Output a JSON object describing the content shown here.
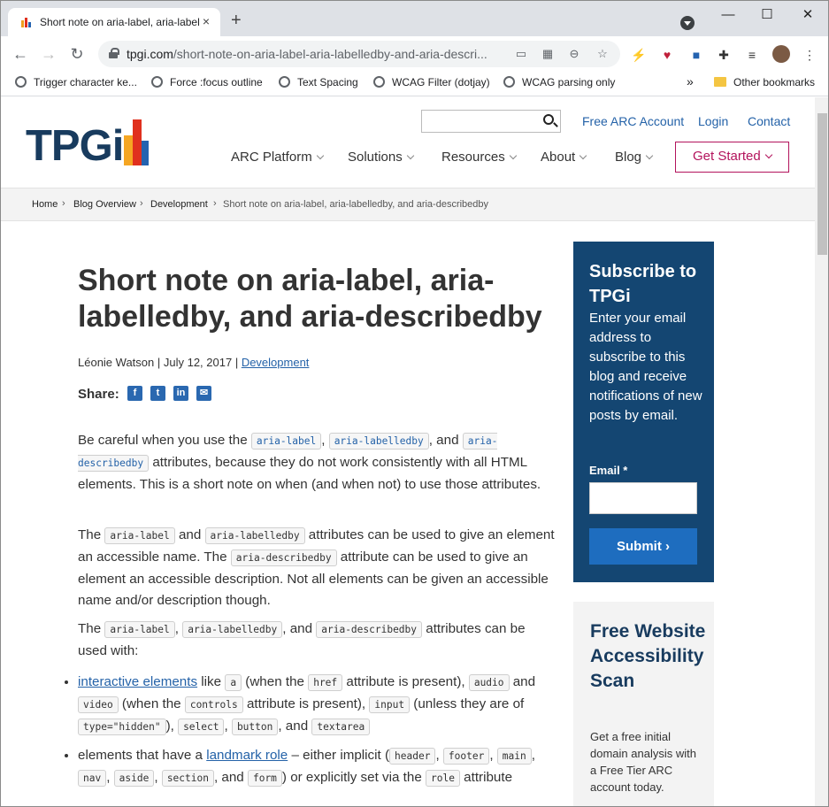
{
  "browser": {
    "tab_title": "Short note on aria-label, aria-labelledby, and aria-describedby",
    "tab_close": "×",
    "new_tab": "+",
    "url_host": "tpgi.com",
    "url_path": "/short-note-on-aria-label-aria-labelledby-and-aria-descri...",
    "bookmarks": [
      "Trigger character ke...",
      "Force :focus outline",
      "Text Spacing",
      "WCAG Filter (dotjay)",
      "WCAG parsing only"
    ],
    "bookmarks_overflow": "»",
    "other_bookmarks": "Other bookmarks"
  },
  "site": {
    "logo_text": "TPGi",
    "top_links": [
      "Free ARC Account",
      "Login",
      "Contact"
    ],
    "nav": [
      "ARC Platform",
      "Solutions",
      "Resources",
      "About",
      "Blog"
    ],
    "get_started": "Get Started"
  },
  "breadcrumb": [
    "Home",
    "Blog Overview",
    "Development",
    "Short note on aria-label, aria-labelledby, and aria-describedby"
  ],
  "breadcrumb_sep": "›",
  "post": {
    "title": "Short note on aria-label, aria-labelledby, and aria-describedby",
    "author": "Léonie Watson",
    "date": "July 12, 2017",
    "category": "Development",
    "share_label": "Share:",
    "p1": {
      "t1": "Be careful when you use the ",
      "c1": "aria-label",
      "t2": ", ",
      "c2": "aria-labelledby",
      "t3": ", and ",
      "c3": "aria-describedby",
      "t4": " attributes, because they do not work consistently with all HTML elements. This is a short note on when (and when not) to use those attributes."
    },
    "p2": {
      "t1": "The ",
      "c1": "aria-label",
      "t2": " and ",
      "c2": "aria-labelledby",
      "t3": " attributes can be used to give an element an accessible name. The ",
      "c3": "aria-describedby",
      "t4": " attribute can be used to give an element an accessible description. Not all elements can be given an accessible name and/or description though."
    },
    "p3": {
      "t1": "The ",
      "c1": "aria-label",
      "t2": ", ",
      "c2": "aria-labelledby",
      "t3": ", and ",
      "c3": "aria-describedby",
      "t4": " attributes can be used with:"
    },
    "li1": {
      "link": "interactive elements",
      "t1": " like ",
      "c_a": "a",
      "t2": " (when the ",
      "c_href": "href",
      "t3": " attribute is present), ",
      "c_audio": "audio",
      "t4": " and ",
      "c_video": "video",
      "t5": " (when the ",
      "c_controls": "controls",
      "t6": " attribute is present), ",
      "c_input": "input",
      "t7": " (unless they are of ",
      "c_hidden": "type=\"hidden\"",
      "t8": "), ",
      "c_select": "select",
      "t9": ", ",
      "c_button": "button",
      "t10": ", and ",
      "c_textarea": "textarea"
    },
    "li2": {
      "t1": "elements that have a ",
      "link": "landmark role",
      "t2": " – either implicit (",
      "c_header": "header",
      "t3": ", ",
      "c_footer": "footer",
      "t4": ", ",
      "c_main": "main",
      "t5": ", ",
      "c_nav": "nav",
      "t6": ", ",
      "c_aside": "aside",
      "t7": ", ",
      "c_section": "section",
      "t8": ", and ",
      "c_form": "form",
      "t9": ") or explicitly set via the ",
      "c_role": "role",
      "t10": " attribute"
    }
  },
  "subscribe": {
    "title": "Subscribe to TPGi",
    "desc": "Enter your email address to subscribe to this blog and receive notifications of new posts by email.",
    "email_label": "Email *",
    "submit": "Submit ›"
  },
  "scan": {
    "title": "Free Website Accessibility Scan",
    "desc": "Get a free initial domain analysis with a Free Tier ARC account today."
  },
  "colors": {
    "brand_navy": "#183b5e",
    "link": "#2462a8",
    "get_started": "#b3135c",
    "subscribe_bg": "#144672",
    "submit_bg": "#1e6dbf"
  }
}
